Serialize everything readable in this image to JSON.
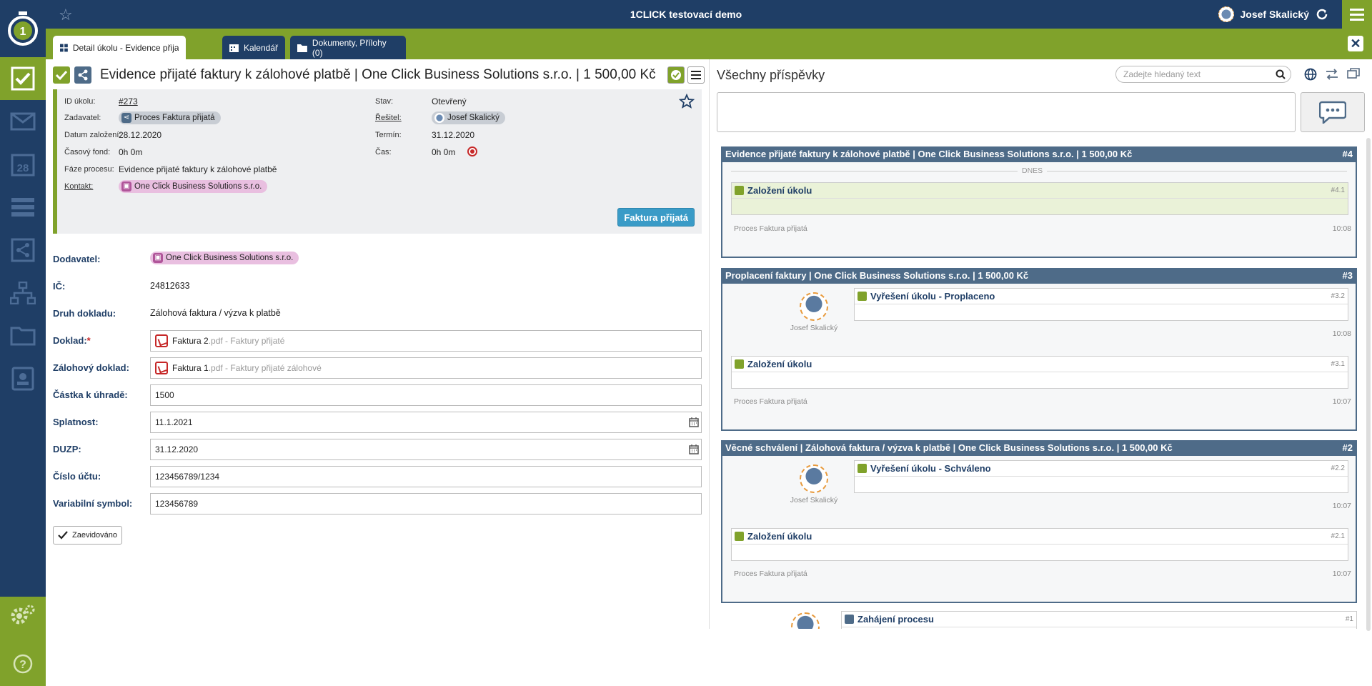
{
  "app": {
    "title": "1CLICK testovací demo",
    "user": "Josef Skalický"
  },
  "tabs": [
    {
      "label": "Detail úkolu - Evidence přijaté fak ..."
    },
    {
      "label": "Kalendář"
    },
    {
      "label": "Dokumenty, Přílohy (0)"
    }
  ],
  "task": {
    "title": "Evidence přijaté faktury k zálohové platbě | One Click Business Solutions s.r.o. | 1 500,00 Kč",
    "info": {
      "id_label": "ID úkolu:",
      "id_value": "#273",
      "zadavatel_label": "Zadavatel:",
      "zadavatel_value": "Proces Faktura přijatá",
      "datum_label": "Datum založení:",
      "datum_value": "28.12.2020",
      "fond_label": "Časový fond:",
      "fond_value": "0h 0m",
      "faze_label": "Fáze procesu:",
      "faze_value": "Evidence přijaté faktury k zálohové platbě",
      "kontakt_label": "Kontakt:",
      "kontakt_value": "One Click Business Solutions s.r.o.",
      "stav_label": "Stav:",
      "stav_value": "Otevřený",
      "resitel_label": "Řešitel:",
      "resitel_value": "Josef Skalický",
      "termin_label": "Termín:",
      "termin_value": "31.12.2020",
      "cas_label": "Čas:",
      "cas_value": "0h 0m"
    },
    "action_button": "Faktura přijatá"
  },
  "form": {
    "dodavatel_label": "Dodavatel:",
    "dodavatel_value": "One Click Business Solutions s.r.o.",
    "ic_label": "IČ:",
    "ic_value": "24812633",
    "druh_label": "Druh dokladu:",
    "druh_value": "Zálohová faktura / výzva k platbě",
    "doklad_label": "Doklad:",
    "doklad_required": "*",
    "doklad_file": "Faktura 2",
    "doklad_ext": ".pdf - Faktury přijaté",
    "zaloh_label": "Zálohový doklad:",
    "zaloh_file": "Faktura 1",
    "zaloh_ext": ".pdf - Faktury přijaté zálohové",
    "castka_label": "Částka k úhradě:",
    "castka_value": "1500",
    "splatnost_label": "Splatnost:",
    "splatnost_value": "11.1.2021",
    "duzp_label": "DUZP:",
    "duzp_value": "31.12.2020",
    "ucet_label": "Číslo účtu:",
    "ucet_value": "123456789/1234",
    "vs_label": "Variabilní symbol:",
    "vs_value": "123456789",
    "zaevidovano": "Zaevidováno"
  },
  "feed": {
    "title": "Všechny příspěvky",
    "search_placeholder": "Zadejte hledaný text",
    "cards": [
      {
        "title": "Evidence přijaté faktury k zálohové platbě | One Click Business Solutions s.r.o. | 1 500,00 Kč",
        "num": "#4",
        "divider": "DNES",
        "msg1": {
          "title": "Založení úkolu",
          "num": "#4.1"
        },
        "meta_left": "Proces Faktura přijatá",
        "meta_right": "10:08"
      },
      {
        "title": "Proplacení faktury | One Click Business Solutions s.r.o. | 1 500,00 Kč",
        "num": "#3",
        "author": "Josef Skalický",
        "msg1": {
          "title": "Vyřešení úkolu - Proplaceno",
          "num": "#3.2",
          "time": "10:08"
        },
        "msg2": {
          "title": "Založení úkolu",
          "num": "#3.1"
        },
        "meta_left": "Proces Faktura přijatá",
        "meta_right": "10:07"
      },
      {
        "title": "Věcné schválení | Zálohová faktura / výzva k platbě | One Click Business Solutions s.r.o. | 1 500,00 Kč",
        "num": "#2",
        "author": "Josef Skalický",
        "msg1": {
          "title": "Vyřešení úkolu - Schváleno",
          "num": "#2.2",
          "time": "10:07"
        },
        "msg2": {
          "title": "Založení úkolu",
          "num": "#2.1"
        },
        "meta_left": "Proces Faktura přijatá",
        "meta_right": "10:07"
      },
      {
        "msg1": {
          "title": "Zahájení procesu",
          "num": "#1"
        }
      }
    ]
  },
  "colors": {
    "navy": "#1f3e66",
    "green": "#80a22b",
    "card_head": "#4e6b88",
    "button_blue": "#3a9bc7"
  }
}
